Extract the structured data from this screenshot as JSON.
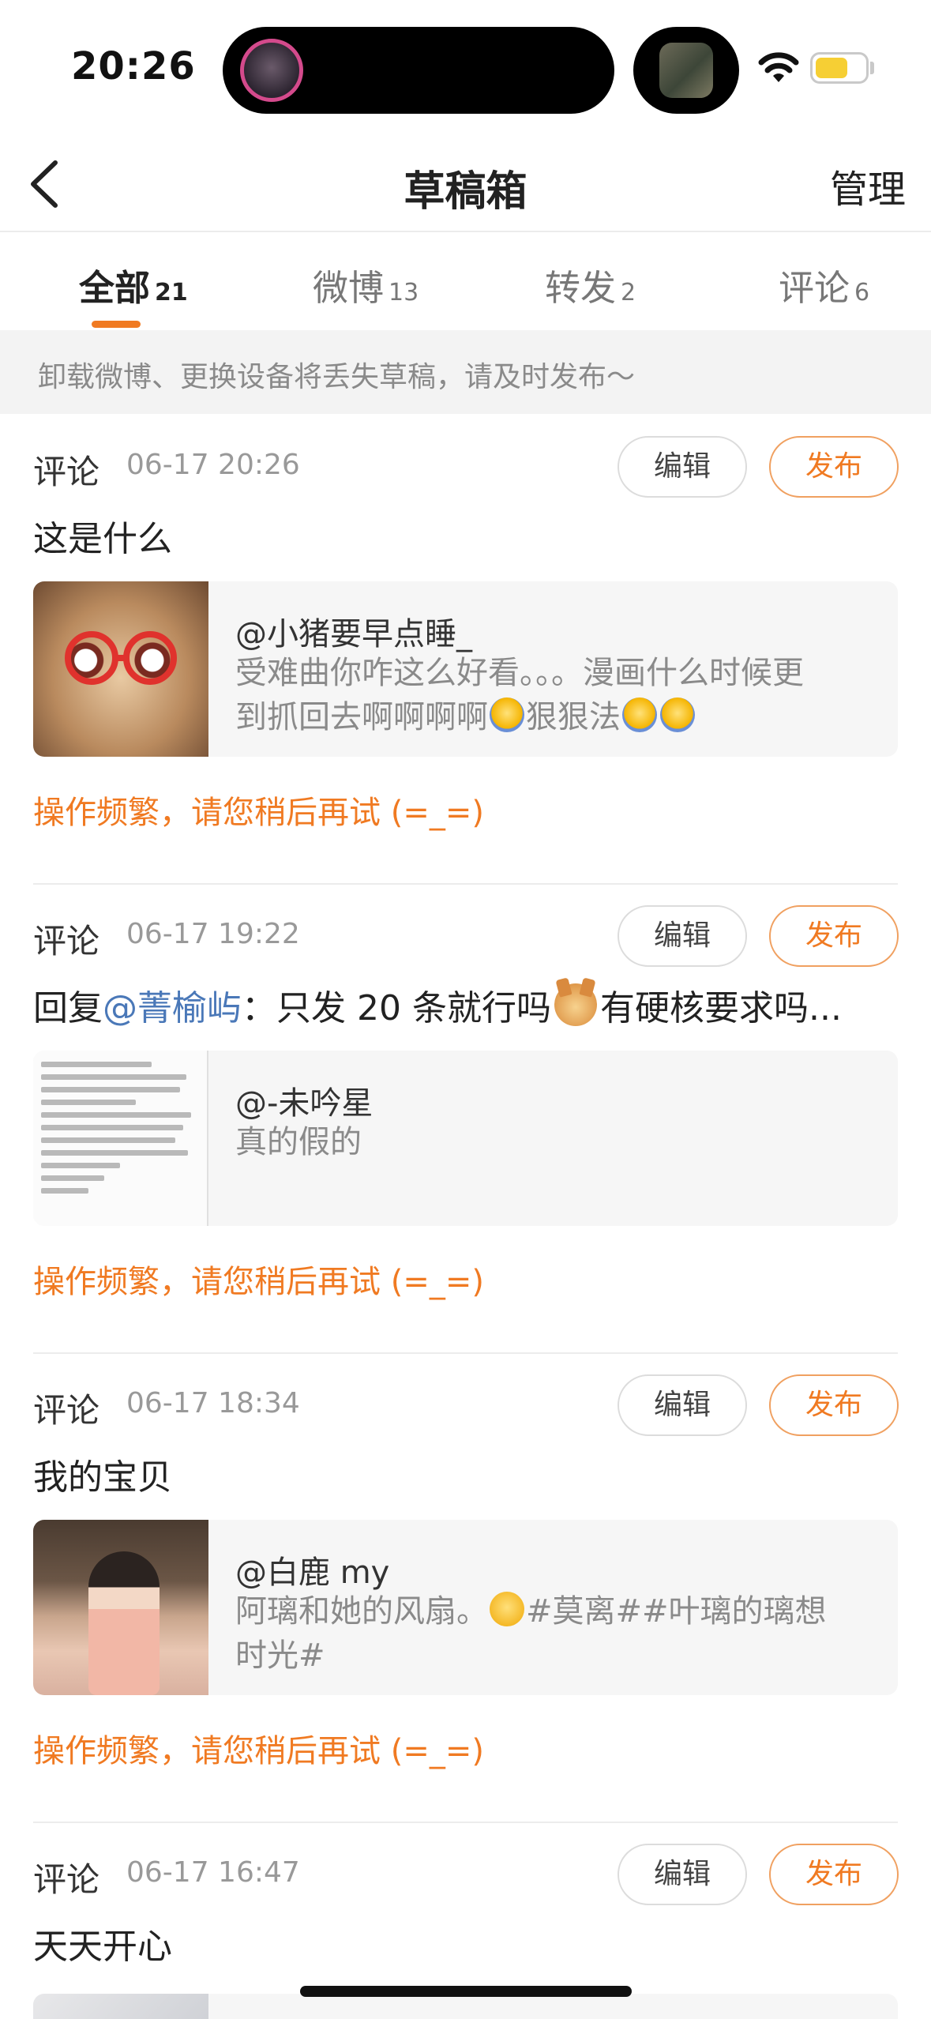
{
  "status_bar": {
    "time": "20:26"
  },
  "nav": {
    "title": "草稿箱",
    "manage_label": "管理"
  },
  "tabs": [
    {
      "label": "全部",
      "count": "21",
      "active": true
    },
    {
      "label": "微博",
      "count": "13",
      "active": false
    },
    {
      "label": "转发",
      "count": "2",
      "active": false
    },
    {
      "label": "评论",
      "count": "6",
      "active": false
    }
  ],
  "notice": "卸载微博、更换设备将丢失草稿，请及时发布～",
  "colors": {
    "accent": "#f07a22",
    "mention": "#4a78b8",
    "muted": "#8a8a8a"
  },
  "drafts": [
    {
      "type": "评论",
      "time": "06-17 20:26",
      "edit_label": "编辑",
      "publish_label": "发布",
      "text": "这是什么",
      "card": {
        "user": "@小猪要早点睡_",
        "line1": "受难曲你咋这么好看。。。漫画什么时候更",
        "line2_a": "到抓回去啊啊啊啊",
        "line2_b": "狠狠法",
        "thumb_icon": "cat-with-red-glasses-image"
      },
      "error": "操作频繁，请您稍后再试 (=_=)"
    },
    {
      "type": "评论",
      "time": "06-17 19:22",
      "edit_label": "编辑",
      "publish_label": "发布",
      "reply_prefix": "回复",
      "reply_mention": "@菁榆屿",
      "reply_text_a": "：只发 20 条就行吗",
      "reply_text_b": "有硬核要求吗...",
      "card": {
        "user": "@-未吟星",
        "line1": "真的假的",
        "thumb_icon": "document-screenshot-image"
      },
      "error": "操作频繁，请您稍后再试 (=_=)"
    },
    {
      "type": "评论",
      "time": "06-17 18:34",
      "edit_label": "编辑",
      "publish_label": "发布",
      "text": " 我的宝贝",
      "card": {
        "user": "@白鹿 my",
        "line1_a": "阿璃和她的风扇。",
        "line1_b": "#莫离##叶璃的璃想",
        "line2": "时光#",
        "thumb_icon": "woman-in-hanfu-photo"
      },
      "error": "操作频繁，请您稍后再试 (=_=)"
    },
    {
      "type": "评论",
      "time": "06-17 16:47",
      "edit_label": "编辑",
      "publish_label": "发布",
      "text": "天天开心"
    }
  ]
}
